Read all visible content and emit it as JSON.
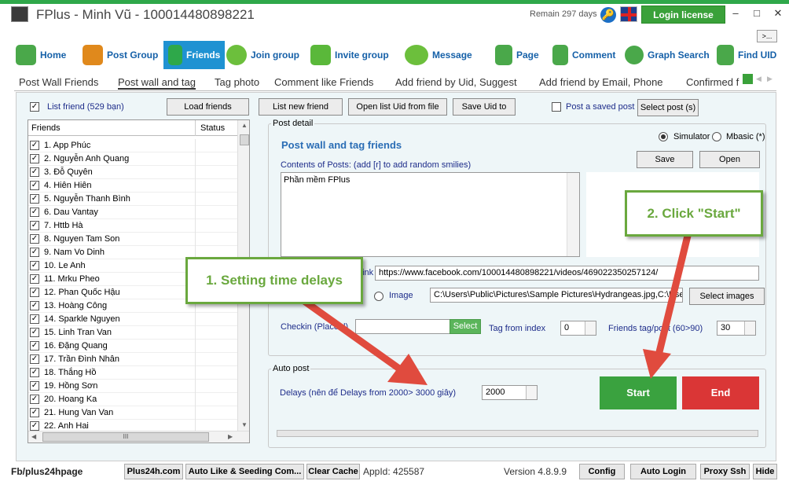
{
  "window": {
    "title": "FPlus - Minh Vũ - 100014480898221",
    "remain": "Remain 297 days",
    "help_icon_glyph": "🔑",
    "login_license": "Login license",
    "minimize": "–",
    "maximize": "□",
    "close": "✕",
    "more": ">..."
  },
  "nav": {
    "tabs": [
      {
        "label": "Home",
        "icon": "home-icon",
        "color": "#4aa84a"
      },
      {
        "label": "Post Group",
        "icon": "group-icon",
        "color": "#e0891c"
      },
      {
        "label": "Friends",
        "icon": "friends-icon",
        "color": "#2ea84a"
      },
      {
        "label": "Join group",
        "icon": "join-group-icon",
        "color": "#6cbf3c"
      },
      {
        "label": "Invite group",
        "icon": "invite-group-icon",
        "color": "#5ab83a"
      },
      {
        "label": "Message",
        "icon": "message-icon",
        "color": "#6cbf3c"
      },
      {
        "label": "Page",
        "icon": "page-icon",
        "color": "#4aa84a"
      },
      {
        "label": "Comment",
        "icon": "comment-icon",
        "color": "#4aa84a"
      },
      {
        "label": "Graph Search",
        "icon": "search-icon",
        "color": "#4aa84a"
      },
      {
        "label": "Find UID",
        "icon": "find-uid-icon",
        "color": "#4aa84a"
      }
    ]
  },
  "subtabs": [
    "Post Wall Friends",
    "Post wall and tag",
    "Tag photo",
    "Comment like Friends",
    "Add friend by Uid, Suggest",
    "Add friend by Email, Phone",
    "Confirmed f"
  ],
  "toolbar": {
    "list_friend_label": "List friend (529 bạn)",
    "load_friends": "Load friends",
    "list_new_friend": "List new friend",
    "open_list_uid": "Open list Uid from file",
    "save_uid": "Save Uid to",
    "post_saved_label": "Post a saved post",
    "select_post": "Select post (s)"
  },
  "friends_table": {
    "columns": [
      "Friends",
      "Status"
    ],
    "rows": [
      "1. App Phúc",
      "2. Nguyễn Anh Quang",
      "3. Đỗ Quyên",
      "4. Hiên Hiên",
      "5. Nguyễn Thanh Bình",
      "6. Dau Vantay",
      "7. Httb Hà",
      "8. Nguyen Tam Son",
      "9. Nam Vo Dinh",
      "10. Le Anh",
      "11. Mrku Pheo",
      "12. Phan Quốc Hậu",
      "13. Hoàng Công",
      "14. Sparkle Nguyen",
      "15. Linh Tran Van",
      "16. Đặng Quang",
      "17. Trần Đình Nhân",
      "18. Thắng Hồ",
      "19. Hồng Sơn",
      "20. Hoang Ka",
      "21. Hung Van Van",
      "22. Anh Hai"
    ],
    "check_glyph": "✓",
    "scroll_up": "▲",
    "scroll_down": "▼",
    "scroll_left": "◀",
    "scroll_right": "▶",
    "hthumb": "III"
  },
  "post_detail": {
    "group_title": "Post detail",
    "heading": "Post wall and tag friends",
    "simulator": "Simulator",
    "mbasic": "Mbasic (*)",
    "contents_label": "Contents of Posts: (add [r] to add random smilies)",
    "save": "Save",
    "open": "Open",
    "content": "Phần mềm FPlus",
    "link_label": "Link",
    "link_value": "https://www.facebook.com/100014480898221/videos/469022350257124/",
    "image_label": "Image",
    "image_path": "C:\\Users\\Public\\Pictures\\Sample Pictures\\Hydrangeas.jpg,C:\\Use",
    "select_images": "Select images",
    "checkin_label": "Checkin (Placeid)",
    "select": "Select",
    "tag_from_label": "Tag from index",
    "tag_from_value": "0",
    "friends_tag_label": "Friends tag/post (60>90)",
    "friends_tag_value": "30"
  },
  "auto_post": {
    "group_title": "Auto post",
    "delays_label": "Delays (nên để Delays from 2000> 3000 giây)",
    "delays_value": "2000",
    "start": "Start",
    "end": "End"
  },
  "callouts": {
    "setting": "1. Setting time delays",
    "start": "2. Click \"Start\""
  },
  "status": {
    "fb": "Fb/plus24hpage",
    "plus24h": "Plus24h.com",
    "auto_like": "Auto Like & Seeding Com...",
    "clear_cache": "Clear Cache",
    "appid": "AppId: 425587",
    "version": "Version 4.8.9.9",
    "config": "Config",
    "auto_login": "Auto Login",
    "proxy_ssh": "Proxy Ssh",
    "hide": "Hide"
  }
}
